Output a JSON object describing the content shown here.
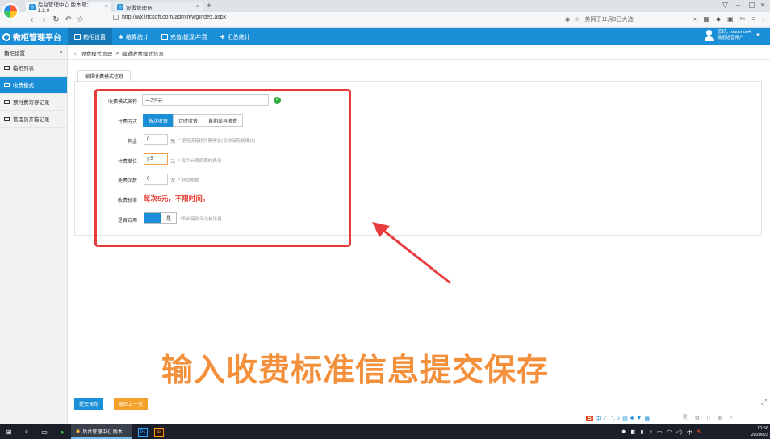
{
  "browser": {
    "tabs": [
      {
        "label": "后台管理中心 版本号：1.2.0",
        "close": "×"
      },
      {
        "label": "设置管理员",
        "close": "×"
      }
    ],
    "newtab": "+",
    "url": "http://wx.iricsoft.com/admin/wgIndex.aspx",
    "news": "美网于11月3日大选",
    "window_controls": [
      "▽",
      "–",
      "▢",
      "×"
    ]
  },
  "app": {
    "logo_text": "微柜管理平台",
    "topnav": [
      "箱柜设置",
      "结算统计",
      "充值\\提现\\年费",
      "汇总统计"
    ],
    "user_greeting": "您好，xiaozhou4",
    "user_role": "微柜运营用户"
  },
  "sidebar": {
    "header": "箱柜设置",
    "items": [
      "箱柜列表",
      "收费模式",
      "预付费寄存记录",
      "管理员开箱记录"
    ]
  },
  "breadcrumb": {
    "parent": "收费模式管理",
    "sep": ">",
    "current": "编辑收费模式信息"
  },
  "form": {
    "tab_label": "编辑收费模式信息",
    "name_label": "收费模式名称",
    "name_value": "一次5元",
    "billing_label": "计费方式",
    "billing_options": [
      "按次收费",
      "计时收费",
      "首期差异收费"
    ],
    "deposit_label": "押金",
    "deposit_value": "0",
    "deposit_unit": "元",
    "deposit_hint": "* 使用该箱柜所需押金(仅物品租赁模式)",
    "unit_label": "计费单位",
    "unit_value": "5",
    "unit_unit": "元",
    "unit_hint": "* 每个计费周期的费用",
    "free_label": "免费次数",
    "free_value": "0",
    "free_unit": "次",
    "free_hint": "* 非负整数",
    "standard_label": "收费标准",
    "standard_value": "每次5元，不限时间。",
    "enabled_label": "是否启用",
    "enabled_toggle": "是",
    "enabled_hint": "*不启用则无法被选用"
  },
  "buttons": {
    "submit": "提交保存",
    "back": "返回上一页"
  },
  "caption": "输入收费标准信息提交保存",
  "taskbar": {
    "app_label": "后台管理中心 版本...",
    "time": "10:58",
    "date": "2020/8/3",
    "lang": "中"
  },
  "colors": {
    "primary": "#1a8fd8",
    "highlight": "#e83b3b",
    "caption": "#f4903c",
    "standard": "#e73a2e"
  }
}
